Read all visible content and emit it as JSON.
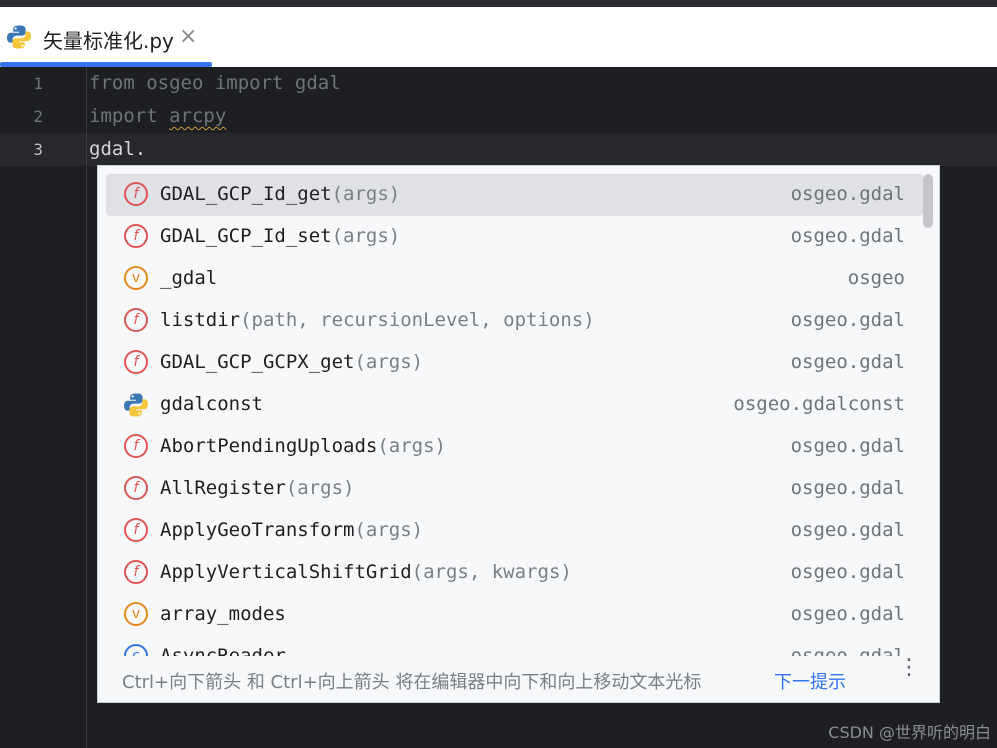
{
  "tab": {
    "title": "矢量标准化.py",
    "close_glyph": "×"
  },
  "editor": {
    "lines": [
      {
        "number": "1",
        "text": "from osgeo import gdal"
      },
      {
        "number": "2",
        "prefix": "import ",
        "squiggle": "arcpy"
      },
      {
        "number": "3",
        "text": "gdal."
      }
    ]
  },
  "completion": {
    "items": [
      {
        "kind": "function",
        "icon_letter": "f",
        "name": "GDAL_GCP_Id_get",
        "args": "(args)",
        "location": "osgeo.gdal",
        "selected": true
      },
      {
        "kind": "function",
        "icon_letter": "f",
        "name": "GDAL_GCP_Id_set",
        "args": "(args)",
        "location": "osgeo.gdal"
      },
      {
        "kind": "variable",
        "icon_letter": "v",
        "name": "_gdal",
        "args": "",
        "location": "osgeo"
      },
      {
        "kind": "function",
        "icon_letter": "f",
        "name": "listdir",
        "args": "(path, recursionLevel, options)",
        "location": "osgeo.gdal"
      },
      {
        "kind": "function",
        "icon_letter": "f",
        "name": "GDAL_GCP_GCPX_get",
        "args": "(args)",
        "location": "osgeo.gdal"
      },
      {
        "kind": "module",
        "icon_letter": "",
        "name": "gdalconst",
        "args": "",
        "location": "osgeo.gdalconst"
      },
      {
        "kind": "function",
        "icon_letter": "f",
        "name": "AbortPendingUploads",
        "args": "(args)",
        "location": "osgeo.gdal"
      },
      {
        "kind": "function",
        "icon_letter": "f",
        "name": "AllRegister",
        "args": "(args)",
        "location": "osgeo.gdal"
      },
      {
        "kind": "function",
        "icon_letter": "f",
        "name": "ApplyGeoTransform",
        "args": "(args)",
        "location": "osgeo.gdal"
      },
      {
        "kind": "function",
        "icon_letter": "f",
        "name": "ApplyVerticalShiftGrid",
        "args": "(args, kwargs)",
        "location": "osgeo.gdal"
      },
      {
        "kind": "variable",
        "icon_letter": "v",
        "name": "array_modes",
        "args": "",
        "location": "osgeo.gdal"
      },
      {
        "kind": "class",
        "icon_letter": "c",
        "name": "AsyncReader",
        "args": "",
        "location": "osgeo.gdal"
      }
    ],
    "footer_hint": "Ctrl+向下箭头 和 Ctrl+向上箭头 将在编辑器中向下和向上移动文本光标",
    "footer_link": "下一提示",
    "more_glyph": "⋮"
  },
  "watermark": "CSDN @世界听的明白",
  "colors": {
    "accent": "#3574f0",
    "function_icon": "#e05555",
    "variable_icon": "#e3881e"
  }
}
